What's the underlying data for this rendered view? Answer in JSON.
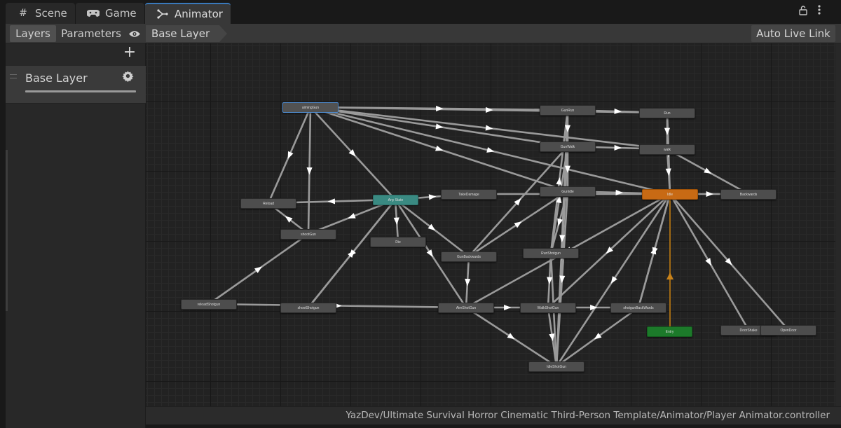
{
  "tabs": [
    {
      "id": "scene",
      "label": "Scene",
      "icon": "grid-icon"
    },
    {
      "id": "game",
      "label": "Game",
      "icon": "gamepad-icon"
    },
    {
      "id": "animator",
      "label": "Animator",
      "icon": "animator-icon",
      "active": true
    }
  ],
  "left_panel": {
    "layers_label": "Layers",
    "parameters_label": "Parameters",
    "eye_icon": "eye-icon",
    "add_icon": "plus-icon",
    "layers": [
      {
        "name": "Base Layer",
        "weight": 1.0
      }
    ]
  },
  "breadcrumb": {
    "current": "Base Layer"
  },
  "auto_live_link_label": "Auto Live Link",
  "status_path": "YazDev/Ultimate Survival Horror Cinematic Third-Person Template/Animator/Player Animator.controller",
  "colors": {
    "any_state": "#3a8a82",
    "entry": "#1c7a2a",
    "default_state": "#c86a14",
    "state": "#4d4d4d",
    "selected_outline": "#4f8ccf",
    "transition": "#9a9a9a",
    "active_tab_accent": "#3a79bb"
  },
  "states": [
    {
      "id": "aiming",
      "name": "aimingGun",
      "selected": true
    },
    {
      "id": "gunrun",
      "name": "GunRun"
    },
    {
      "id": "run",
      "name": "Run"
    },
    {
      "id": "gunwalk",
      "name": "GunWalk"
    },
    {
      "id": "walk",
      "name": "walk"
    },
    {
      "id": "reload",
      "name": "Reload"
    },
    {
      "id": "anystate",
      "name": "Any State",
      "kind": "anystate"
    },
    {
      "id": "takedamage",
      "name": "TakeDamage"
    },
    {
      "id": "gunidle",
      "name": "GunIdle"
    },
    {
      "id": "idle",
      "name": "Idle",
      "kind": "default"
    },
    {
      "id": "backwards",
      "name": "Backwards"
    },
    {
      "id": "shootgun",
      "name": "shootGun"
    },
    {
      "id": "die",
      "name": "Die"
    },
    {
      "id": "gunbackwards",
      "name": "GunBackwards"
    },
    {
      "id": "runshotgun",
      "name": "RunShotgun"
    },
    {
      "id": "reloadshotgun",
      "name": "reloadShotgun"
    },
    {
      "id": "shootshotgun",
      "name": "shootShotgun"
    },
    {
      "id": "aimshotgun",
      "name": "AimShotGun"
    },
    {
      "id": "walkshotgun",
      "name": "WalkShotGun"
    },
    {
      "id": "shotgunbackwards",
      "name": "shotgunBackWards"
    },
    {
      "id": "entry",
      "name": "Entry",
      "kind": "entry"
    },
    {
      "id": "doorshake",
      "name": "DoorShake"
    },
    {
      "id": "opendoor",
      "name": "OpenDoor"
    },
    {
      "id": "idleshotgun",
      "name": "IdleShotGun"
    }
  ]
}
